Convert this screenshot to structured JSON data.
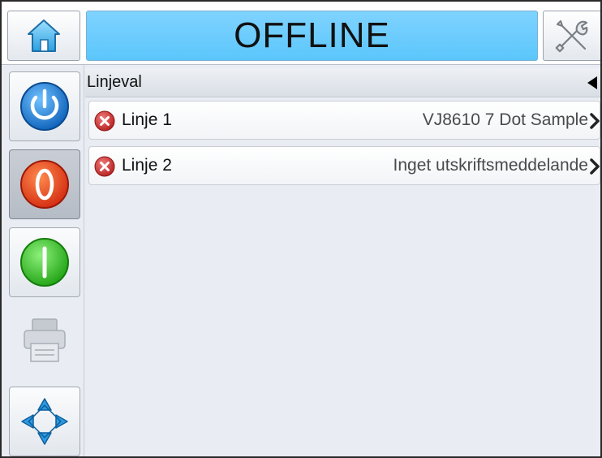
{
  "header": {
    "status": "OFFLINE",
    "home_icon": "home-icon",
    "tools_icon": "tools-icon"
  },
  "sidebar": {
    "buttons": [
      {
        "name": "power-button",
        "icon": "power-icon",
        "color": "#1a7fe0"
      },
      {
        "name": "stop-button",
        "icon": "stop-icon",
        "color": "#e8401c"
      },
      {
        "name": "start-button",
        "icon": "start-icon",
        "color": "#2ec41f"
      },
      {
        "name": "print-button",
        "icon": "printer-icon",
        "state": "disabled"
      },
      {
        "name": "navigate-button",
        "icon": "navigate-arrows-icon",
        "color": "#1e8ed6"
      }
    ]
  },
  "section": {
    "title": "Linjeval"
  },
  "lines": [
    {
      "label": "Linje 1",
      "message": "VJ8610 7 Dot Sample",
      "status_icon": "error-icon"
    },
    {
      "label": "Linje 2",
      "message": "Inget utskriftsmeddelande",
      "status_icon": "error-icon"
    }
  ],
  "colors": {
    "banner": "#5bc6fb",
    "error": "#d23a3a"
  }
}
